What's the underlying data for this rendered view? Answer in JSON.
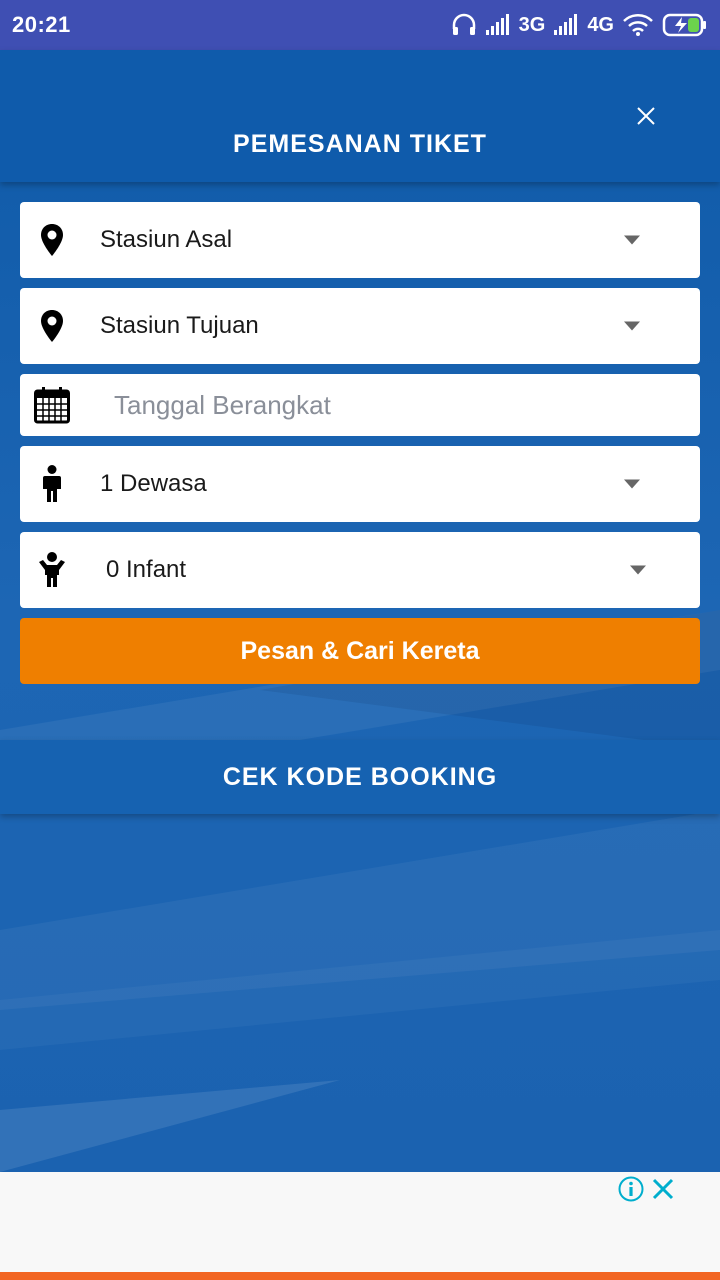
{
  "status_bar": {
    "time": "20:21",
    "network_1": "3G",
    "network_2": "4G",
    "icons": [
      "headphones-icon",
      "signal-icon",
      "wifi-icon",
      "battery-charging-icon"
    ]
  },
  "header": {
    "title": "PEMESANAN TIKET",
    "close_icon": "close-icon"
  },
  "form": {
    "origin": {
      "value": "Stasiun Asal",
      "icon": "location-pin-icon"
    },
    "destination": {
      "value": "Stasiun Tujuan",
      "icon": "location-pin-icon"
    },
    "date": {
      "placeholder": "Tanggal Berangkat",
      "icon": "calendar-icon"
    },
    "adults": {
      "value": "1 Dewasa",
      "icon": "adult-person-icon"
    },
    "infants": {
      "value": "0 Infant",
      "icon": "child-person-icon"
    },
    "submit_label": "Pesan & Cari Kereta"
  },
  "booking": {
    "label": "CEK KODE BOOKING"
  },
  "ad": {
    "icons": [
      "info-icon",
      "close-icon"
    ]
  },
  "colors": {
    "status_bar": "#3f4fb3",
    "header": "#0f5bab",
    "background": "#1a5fae",
    "submit": "#ef7f00",
    "bottom_strip": "#f26522"
  }
}
